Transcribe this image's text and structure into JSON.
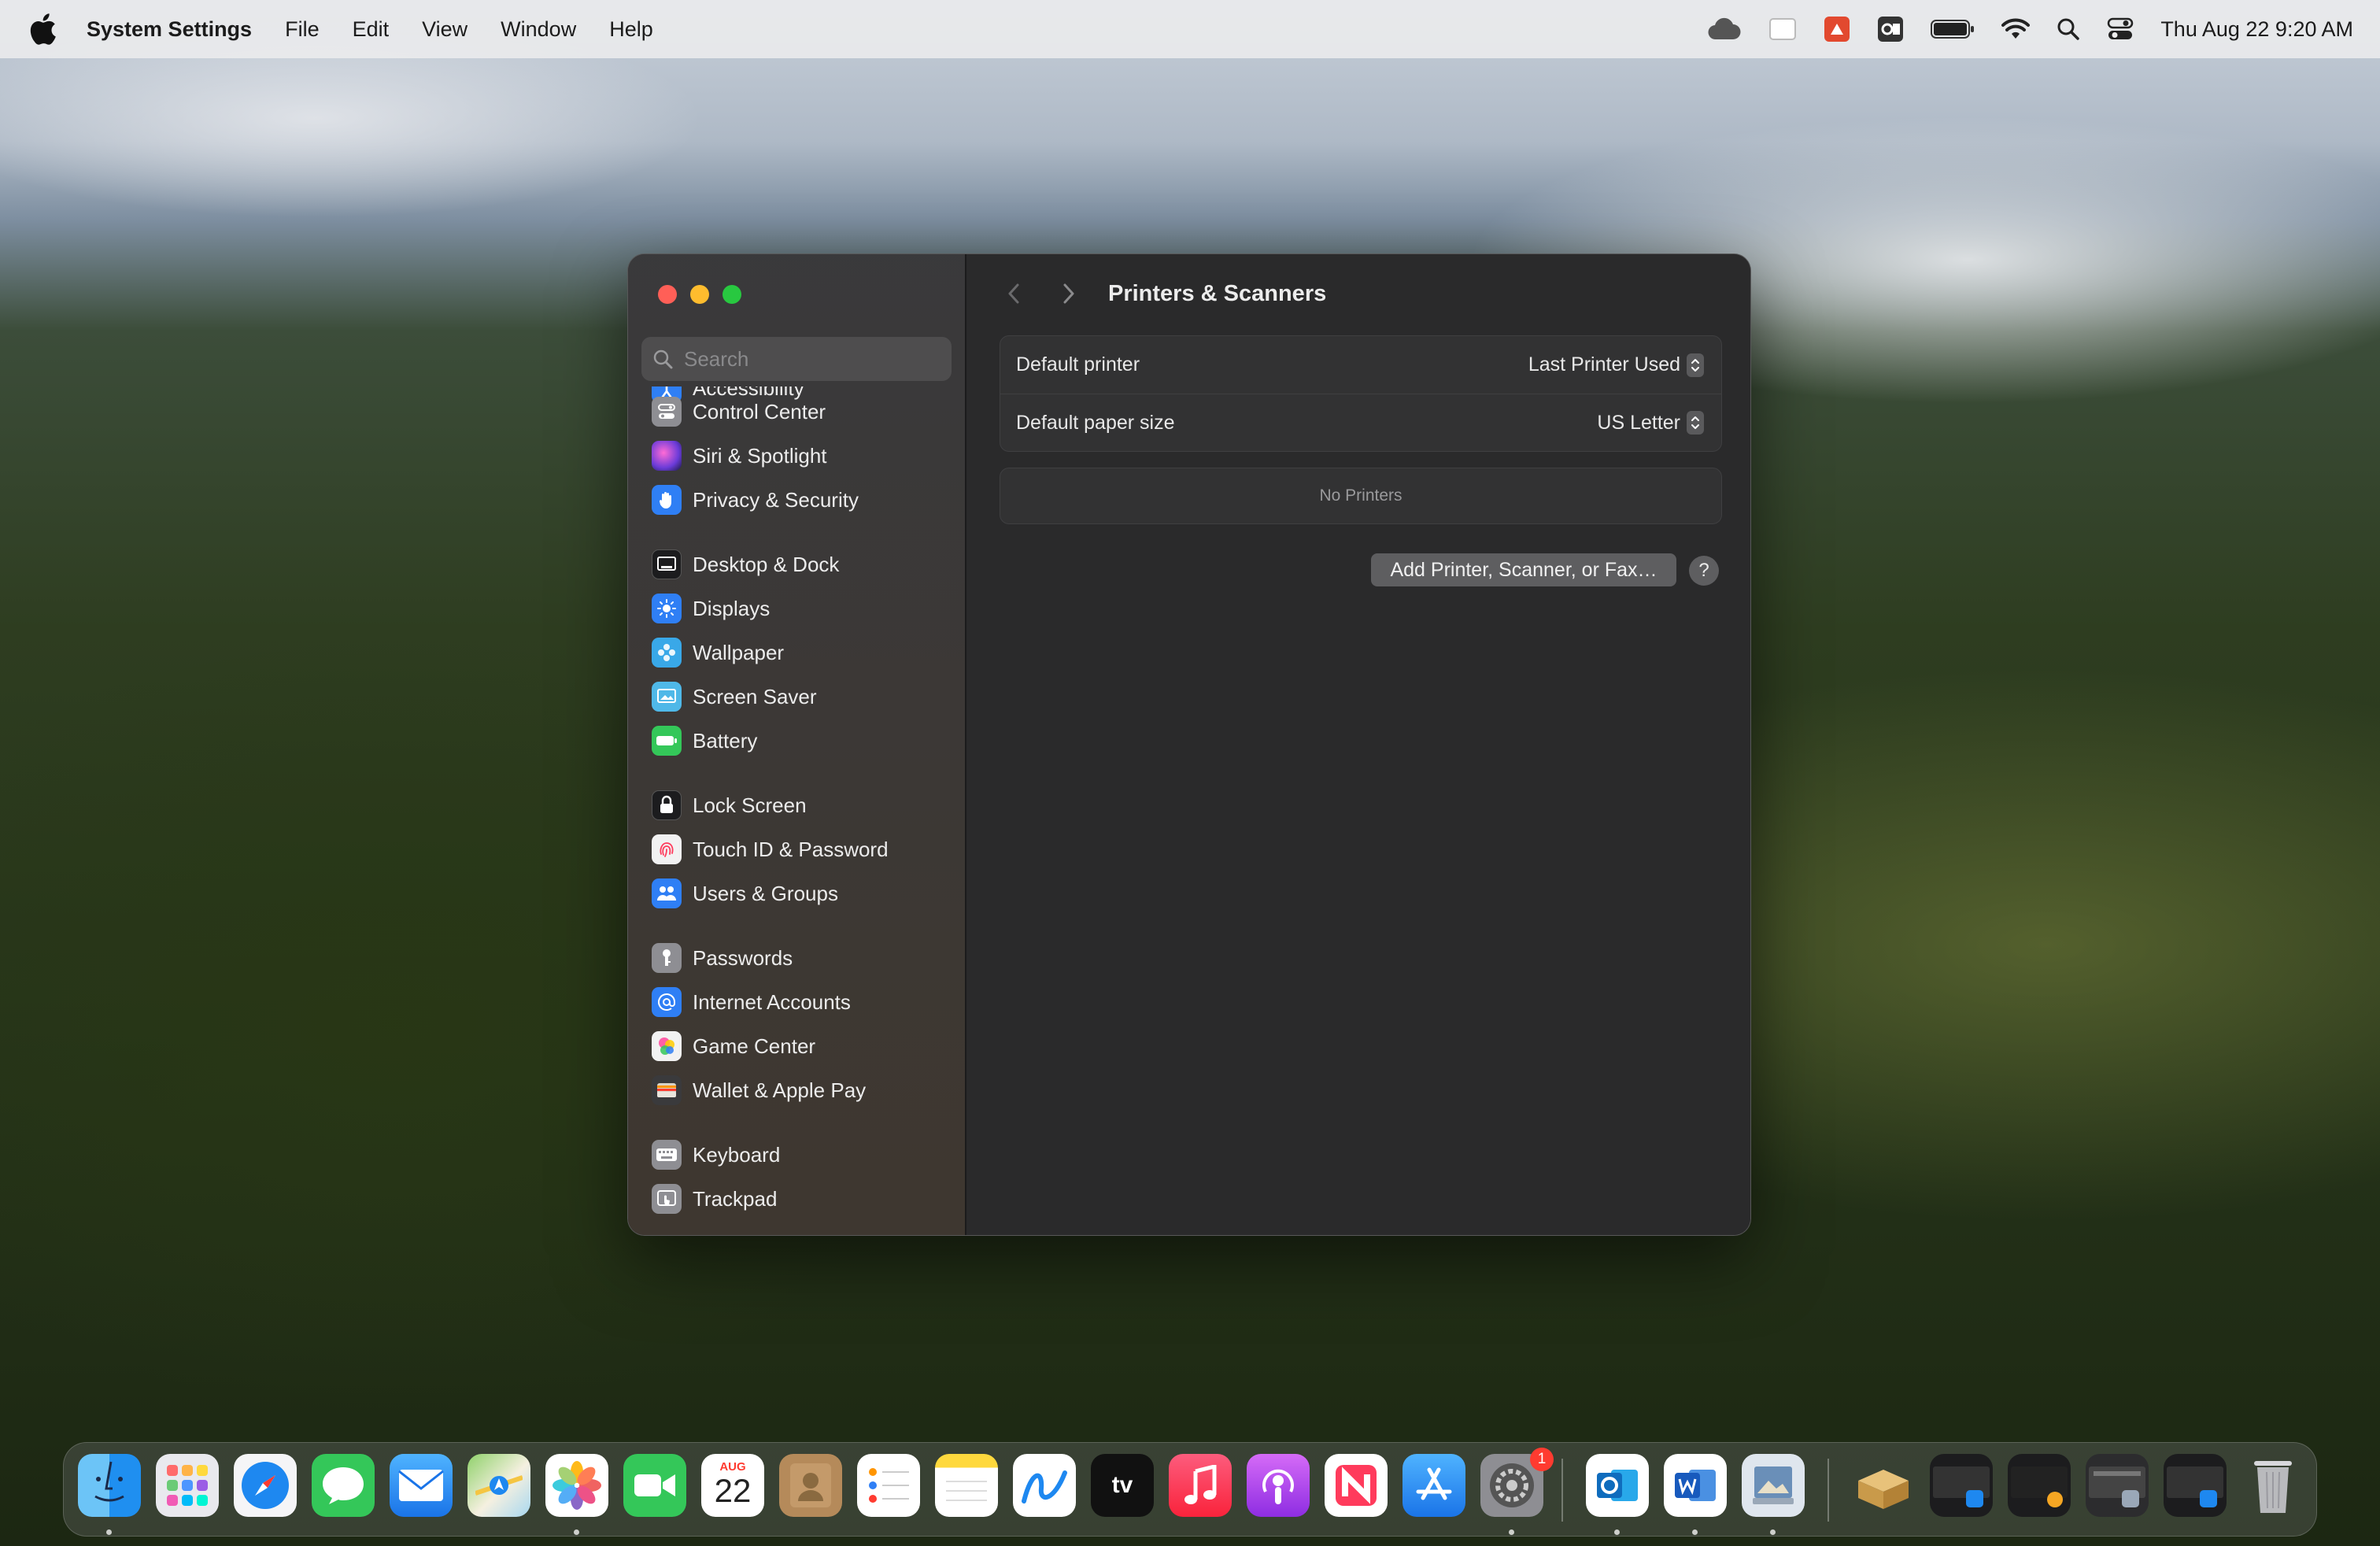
{
  "menubar": {
    "app_name": "System Settings",
    "menus": [
      "File",
      "Edit",
      "View",
      "Window",
      "Help"
    ],
    "clock": "Thu Aug 22  9:20 AM"
  },
  "window": {
    "title": "Printers & Scanners",
    "search_placeholder": "Search",
    "sidebar_items": [
      {
        "label": "Accessibility",
        "icon": "accessibility-icon",
        "color": "#2f7ff5"
      },
      {
        "label": "Control Center",
        "icon": "control-center-icon",
        "color": "#8e8e93"
      },
      {
        "label": "Siri & Spotlight",
        "icon": "siri-icon",
        "color": "#a34fd6"
      },
      {
        "label": "Privacy & Security",
        "icon": "hand-icon",
        "color": "#2f7ff5"
      },
      {
        "label": "Desktop & Dock",
        "icon": "desktop-dock-icon",
        "color": "#1c1c1e"
      },
      {
        "label": "Displays",
        "icon": "displays-icon",
        "color": "#2f7ff5"
      },
      {
        "label": "Wallpaper",
        "icon": "wallpaper-icon",
        "color": "#39a8e8"
      },
      {
        "label": "Screen Saver",
        "icon": "screen-saver-icon",
        "color": "#4fb8e8"
      },
      {
        "label": "Battery",
        "icon": "battery-icon",
        "color": "#34c759"
      },
      {
        "label": "Lock Screen",
        "icon": "lock-icon",
        "color": "#1c1c1e"
      },
      {
        "label": "Touch ID & Password",
        "icon": "fingerprint-icon",
        "color": "#f2f2f2"
      },
      {
        "label": "Users & Groups",
        "icon": "users-icon",
        "color": "#2f7ff5"
      },
      {
        "label": "Passwords",
        "icon": "key-icon",
        "color": "#8e8e93"
      },
      {
        "label": "Internet Accounts",
        "icon": "at-icon",
        "color": "#2f7ff5"
      },
      {
        "label": "Game Center",
        "icon": "game-center-icon",
        "color": "#f2f2f2"
      },
      {
        "label": "Wallet & Apple Pay",
        "icon": "wallet-icon",
        "color": "#3a3a3c"
      },
      {
        "label": "Keyboard",
        "icon": "keyboard-icon",
        "color": "#8e8e93"
      },
      {
        "label": "Trackpad",
        "icon": "trackpad-icon",
        "color": "#8e8e93"
      }
    ],
    "settings": {
      "default_printer_label": "Default printer",
      "default_printer_value": "Last Printer Used",
      "default_paper_label": "Default paper size",
      "default_paper_value": "US Letter",
      "empty_text": "No Printers",
      "add_button": "Add Printer, Scanner, or Fax…",
      "help_button": "?"
    }
  },
  "dock": {
    "calendar_month": "AUG",
    "calendar_day": "22",
    "settings_badge": "1",
    "apps": [
      "Finder",
      "Launchpad",
      "Safari",
      "Messages",
      "Mail",
      "Maps",
      "Photos",
      "FaceTime",
      "Calendar",
      "Contacts",
      "Reminders",
      "Notes",
      "Freeform",
      "TV",
      "Music",
      "Podcasts",
      "News",
      "App Store",
      "System Settings",
      "Outlook",
      "Word",
      "Preview",
      "Archive",
      "Trash"
    ]
  },
  "colors": {
    "accent": "#2f7ff5",
    "window_bg": "#2a2a2b",
    "close": "#ff5f57",
    "minimize": "#febc2e",
    "zoom": "#28c840"
  }
}
